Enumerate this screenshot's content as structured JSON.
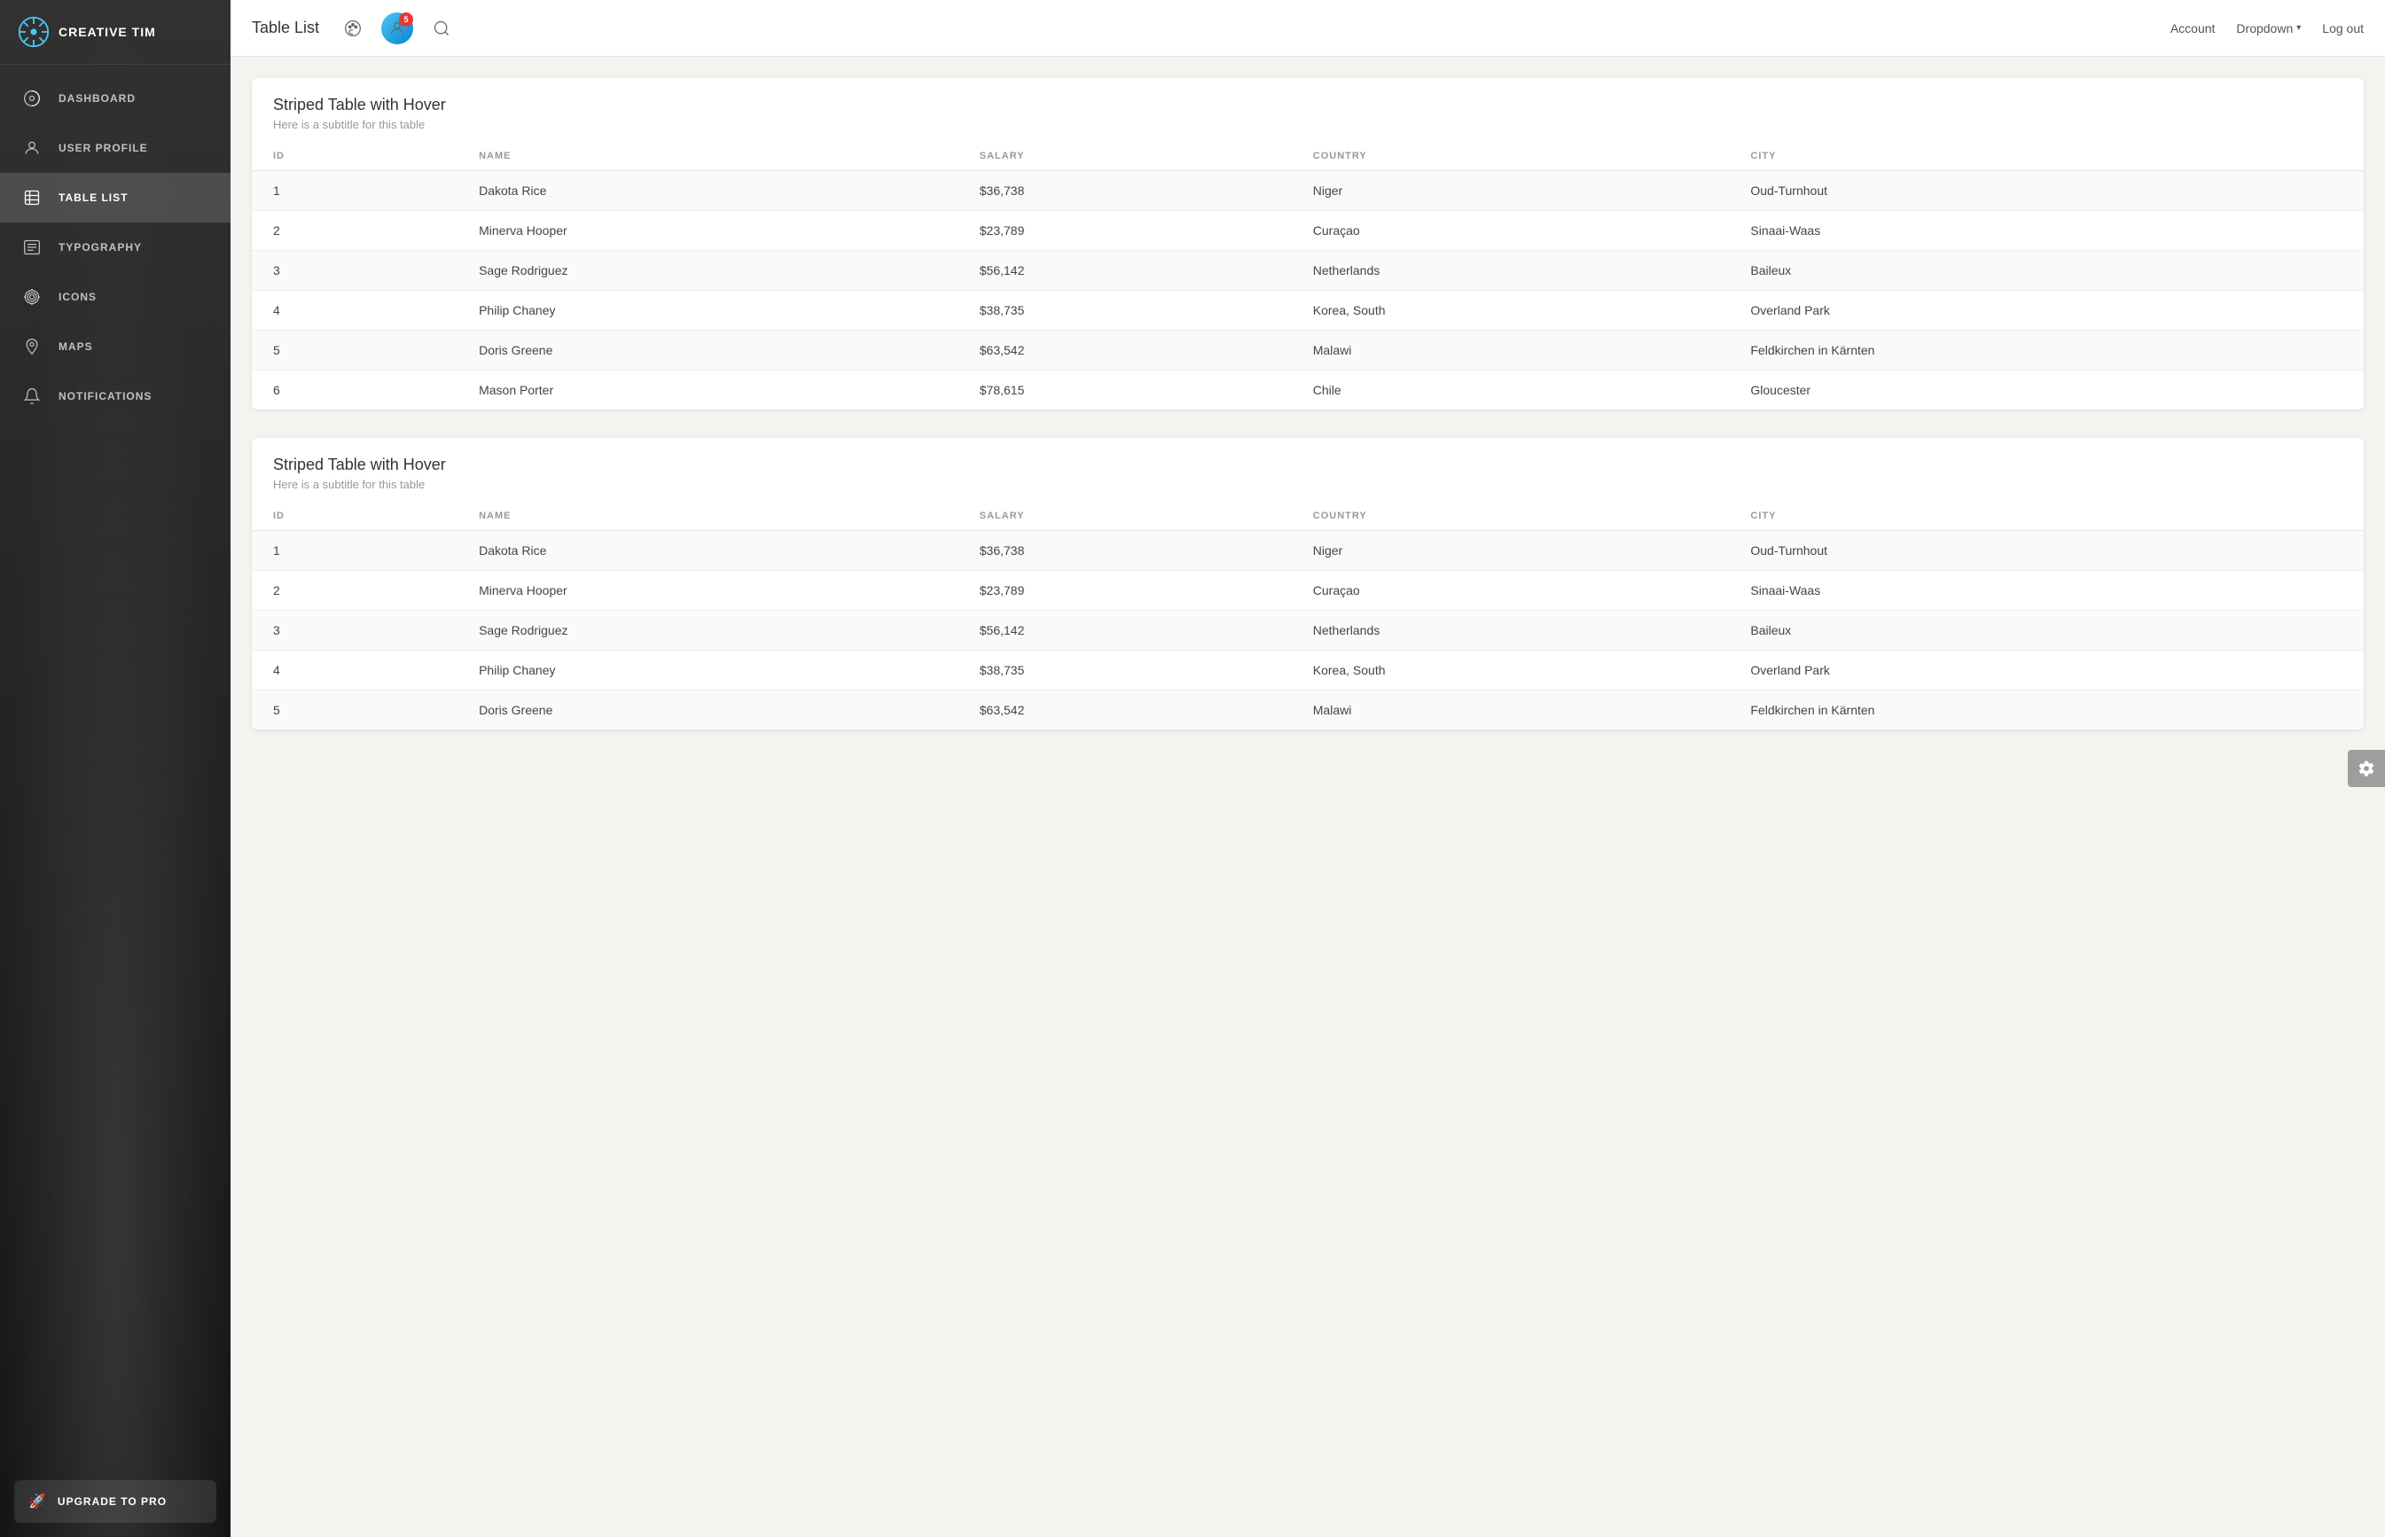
{
  "sidebar": {
    "logo": {
      "text": "CREATIVE TIM"
    },
    "nav_items": [
      {
        "id": "dashboard",
        "label": "DASHBOARD",
        "icon": "dashboard-icon",
        "active": false
      },
      {
        "id": "user-profile",
        "label": "USER PROFILE",
        "icon": "user-icon",
        "active": false
      },
      {
        "id": "table-list",
        "label": "TABLE LIST",
        "icon": "table-icon",
        "active": true
      },
      {
        "id": "typography",
        "label": "TYPOGRAPHY",
        "icon": "typography-icon",
        "active": false
      },
      {
        "id": "icons",
        "label": "ICONS",
        "icon": "icons-icon",
        "active": false
      },
      {
        "id": "maps",
        "label": "MAPS",
        "icon": "maps-icon",
        "active": false
      },
      {
        "id": "notifications",
        "label": "NOTIFICATIONS",
        "icon": "notifications-icon",
        "active": false
      }
    ],
    "upgrade": {
      "label": "UPGRADE TO PRO"
    }
  },
  "header": {
    "title": "Table List",
    "notification_count": "5",
    "account_label": "Account",
    "dropdown_label": "Dropdown",
    "logout_label": "Log out"
  },
  "tables": [
    {
      "id": "table1",
      "title": "Striped Table with Hover",
      "subtitle": "Here is a subtitle for this table",
      "columns": [
        "ID",
        "NAME",
        "SALARY",
        "COUNTRY",
        "CITY"
      ],
      "rows": [
        {
          "id": "1",
          "name": "Dakota Rice",
          "salary": "$36,738",
          "country": "Niger",
          "city": "Oud-Turnhout"
        },
        {
          "id": "2",
          "name": "Minerva Hooper",
          "salary": "$23,789",
          "country": "Curaçao",
          "city": "Sinaai-Waas"
        },
        {
          "id": "3",
          "name": "Sage Rodriguez",
          "salary": "$56,142",
          "country": "Netherlands",
          "city": "Baileux"
        },
        {
          "id": "4",
          "name": "Philip Chaney",
          "salary": "$38,735",
          "country": "Korea, South",
          "city": "Overland Park"
        },
        {
          "id": "5",
          "name": "Doris Greene",
          "salary": "$63,542",
          "country": "Malawi",
          "city": "Feldkirchen in Kärnten"
        },
        {
          "id": "6",
          "name": "Mason Porter",
          "salary": "$78,615",
          "country": "Chile",
          "city": "Gloucester"
        }
      ]
    },
    {
      "id": "table2",
      "title": "Striped Table with Hover",
      "subtitle": "Here is a subtitle for this table",
      "columns": [
        "ID",
        "NAME",
        "SALARY",
        "COUNTRY",
        "CITY"
      ],
      "rows": [
        {
          "id": "1",
          "name": "Dakota Rice",
          "salary": "$36,738",
          "country": "Niger",
          "city": "Oud-Turnhout"
        },
        {
          "id": "2",
          "name": "Minerva Hooper",
          "salary": "$23,789",
          "country": "Curaçao",
          "city": "Sinaai-Waas"
        },
        {
          "id": "3",
          "name": "Sage Rodriguez",
          "salary": "$56,142",
          "country": "Netherlands",
          "city": "Baileux"
        },
        {
          "id": "4",
          "name": "Philip Chaney",
          "salary": "$38,735",
          "country": "Korea, South",
          "city": "Overland Park"
        },
        {
          "id": "5",
          "name": "Doris Greene",
          "salary": "$63,542",
          "country": "Malawi",
          "city": "Feldkirchen in Kärnten"
        }
      ]
    }
  ]
}
